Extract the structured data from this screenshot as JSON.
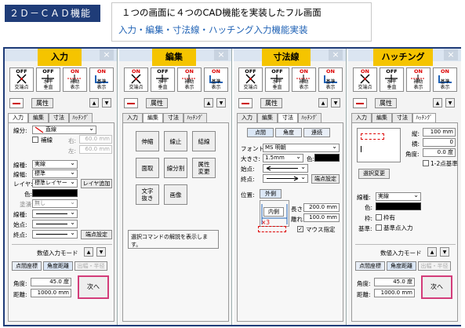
{
  "header": {
    "badge": "２Ｄ－ＣＡＤ機能",
    "line1": "１つの画面に４つのCAD機能を実装したフル画面",
    "line2": "入力・編集・寸法線・ハッチング入力機能実装"
  },
  "common": {
    "close": "×",
    "attr": "属性",
    "up": "▲",
    "down": "▼",
    "tb1_state": "OFF",
    "tb1_label": "交端点",
    "tb2_state": "OFF",
    "tb2_label": "水平\n垂直",
    "tb3_state": "OFF",
    "tb3_label": "補助\n表示",
    "tb4_state": "ON",
    "tb4_label": "基準\n表示"
  },
  "panels": {
    "input": {
      "title": "入力",
      "tabs": [
        "入力",
        "編集",
        "寸法",
        "ﾊｯﾁﾝｸﾞ"
      ],
      "tb1_state": "OFF",
      "tb2_state": "OFF",
      "tb3_state": "ON",
      "tb4_state": "ON",
      "linetype_label": "線分:",
      "linetype_value": "直線",
      "support_label": "補線",
      "right_label": "右:",
      "right_value": "60.0 mm",
      "left_label": "左:",
      "left_value": "60.0 mm",
      "kind_label": "線種:",
      "kind_value": "実線",
      "width_label": "線幅:",
      "width_value": "標準",
      "layer_label": "レイヤ:",
      "layer_value": "標準レイヤー",
      "layer_add": "レイヤ追加",
      "color_label": "色:",
      "fill_label": "塗潰:",
      "fill_value": "無し",
      "linekind_label": "線種:",
      "start_label": "始点:",
      "end_label": "終点:",
      "endpoint_set": "端点設定",
      "numeric_mode": "数値入力モード",
      "mode1": "点間座標",
      "mode2": "角度距離",
      "mode3": "出幅・半径",
      "angle_label": "角度:",
      "angle_value": "45.0 度",
      "dist_label": "距離:",
      "dist_value": "1000.0 mm",
      "next": "次へ"
    },
    "edit": {
      "title": "編集",
      "tabs": [
        "入力",
        "編集",
        "寸法",
        "ﾊｯﾁﾝｸﾞ"
      ],
      "tb1_state": "ON",
      "tb2_state": "OFF",
      "tb3_state": "ON",
      "tb4_state": "ON",
      "buttons": [
        "伸縮",
        "線止",
        "結線",
        "面取",
        "線分割",
        "属性\n変更",
        "文字\n抜き",
        "画像"
      ],
      "description": "選択コマンドの解説を表示します。"
    },
    "dim": {
      "title": "寸法線",
      "tabs": [
        "入力",
        "編集",
        "寸法",
        "ﾊｯﾁﾝｸﾞ"
      ],
      "tb1_state": "OFF",
      "tb2_state": "OFF",
      "tb3_state": "ON",
      "tb4_state": "ON",
      "mode1": "点間",
      "mode2": "角度",
      "mode3": "連続",
      "font_label": "フォント:",
      "font_value": "MS 明朝",
      "size_label": "大きさ:",
      "size_value": "1.5mm",
      "color_label": "色:",
      "start_label": "始点:",
      "end_label": "終点:",
      "endpoint_set": "端点設定",
      "position_label": "位置:",
      "outside": "外側",
      "inside": "内側",
      "length_label": "長さ:",
      "length_value": "200.0 mm",
      "offset_label": "離れ:",
      "offset_value": "100.0 mm",
      "x3": "×3",
      "mouse_label": "マウス指定"
    },
    "hatch": {
      "title": "ハッチング",
      "tabs": [
        "入力",
        "編集",
        "寸法",
        "ﾊｯﾁﾝｸﾞ"
      ],
      "tb1_state": "ON",
      "tb2_state": "OFF",
      "tb3_state": "ON",
      "tb4_state": "ON",
      "vertical_label": "縦:",
      "vertical_value": "100 mm",
      "horizontal_label": "横:",
      "horizontal_value": "0",
      "angle_label": "角度:",
      "angle_value": "0.0 度",
      "base2_label": "1-2点基準",
      "select_change": "選択変更",
      "kind_label": "線種:",
      "kind_value": "実線",
      "color_label": "色:",
      "frame_label": "枠:",
      "frame_check": "枠有",
      "base_label": "基準:",
      "base_check": "基準点入力",
      "numeric_mode": "数値入力モード",
      "mode1": "点間座標",
      "mode2": "角度距離",
      "mode3": "出幅・半径",
      "angle2_label": "角度:",
      "angle2_value": "45.0 度",
      "dist_label": "距離:",
      "dist_value": "1000.0 mm",
      "next": "次へ"
    }
  }
}
